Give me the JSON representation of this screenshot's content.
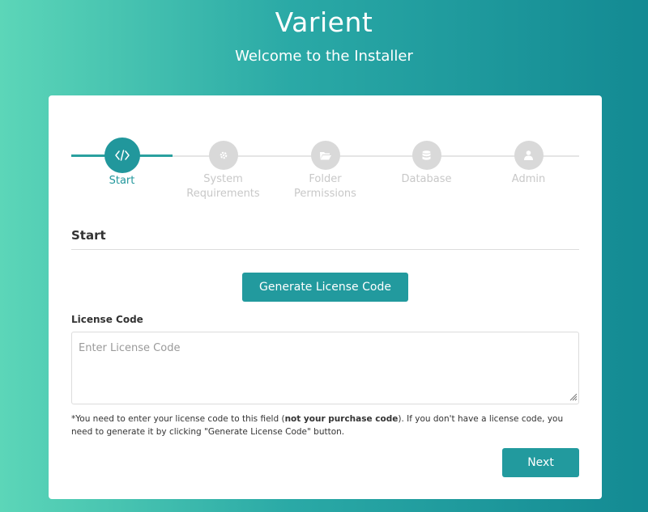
{
  "header": {
    "title": "Varient",
    "subtitle": "Welcome to the Installer"
  },
  "stepper": {
    "steps": [
      {
        "label": "Start",
        "icon": "code-icon",
        "active": true
      },
      {
        "label": "System\nRequirements",
        "icon": "gear-icon",
        "active": false
      },
      {
        "label": "Folder\nPermissions",
        "icon": "folder-icon",
        "active": false
      },
      {
        "label": "Database",
        "icon": "database-icon",
        "active": false
      },
      {
        "label": "Admin",
        "icon": "user-icon",
        "active": false
      }
    ]
  },
  "section": {
    "title": "Start"
  },
  "generate_button": {
    "label": "Generate License Code"
  },
  "license": {
    "label": "License Code",
    "placeholder": "Enter License Code",
    "value": ""
  },
  "note": {
    "part1": "*You need to enter your license code to this field (",
    "bold": "not your purchase code",
    "part2": "). If you don't have a license code, you need to generate it by clicking \"Generate License Code\" button."
  },
  "next_button": {
    "label": "Next"
  },
  "colors": {
    "accent": "#229a9e",
    "inactive_step": "#d9d9d9",
    "bg_gradient_start": "#5cd6b8",
    "bg_gradient_end": "#138a93"
  }
}
